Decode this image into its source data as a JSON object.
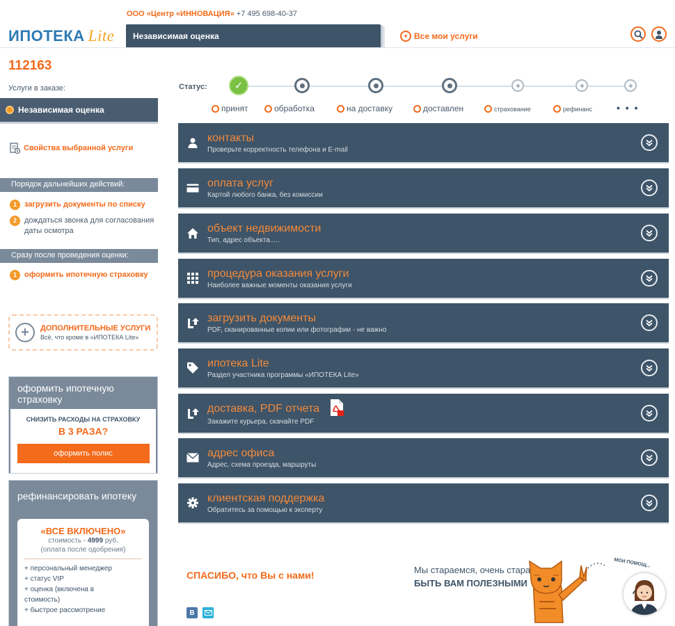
{
  "header": {
    "company_name": "ООО «Центр «ИННОВАЦИЯ»",
    "phone": "+7 495 698-40-37",
    "logo_word": "ИПОТЕКА",
    "logo_lite": "Lite",
    "active_tab": "Независимая оценка",
    "all_services_label": "Все мои услуги",
    "icons": [
      "search-icon",
      "user-icon"
    ]
  },
  "order": {
    "number": "112163",
    "services_caption": "Услуги в заказе:",
    "selected_service": "Независимая оценка",
    "properties_link": "Свойства выбранной услуги"
  },
  "next_steps": {
    "heading": "Порядок дальнейших действий:",
    "items": [
      {
        "num": "1",
        "text": "загрузить документы по списку"
      },
      {
        "num": "2",
        "text": "дождаться звонка для согласования даты осмотра"
      }
    ]
  },
  "after_eval": {
    "heading": "Сразу после проведения оценки:",
    "items": [
      {
        "num": "1",
        "text": "оформить ипотечную страховку"
      }
    ]
  },
  "extra_services": {
    "title": "ДОПОЛНИТЕЛЬНЫЕ УСЛУГИ",
    "subtitle": "Всё, что кроме в «ИПОТЕКА Lite»"
  },
  "insurance_promo": {
    "heading": "оформить ипотечную страховку",
    "small": "СНИЗИТЬ РАСХОДЫ НА СТРАХОВКУ",
    "big": "В 3 РАЗА?",
    "button": "оформить полис"
  },
  "refinance_promo": {
    "heading": "рефинансировать ипотеку",
    "big": "«ВСЕ ВКЛЮЧЕНО»",
    "price_prefix": "стоимость -",
    "price": "4999",
    "price_suffix": "руб.",
    "price_note": "(оплата после одобрения)",
    "features": [
      "+ персональный менеджер",
      "+ статус VIP",
      "+ оценка (включена в",
      "стоимость)",
      "+ быстрое рассмотрение"
    ]
  },
  "status": {
    "label": "Статус:",
    "steps": [
      {
        "label": "принят",
        "state": "done"
      },
      {
        "label": "обработка",
        "state": "active"
      },
      {
        "label": "на доставку",
        "state": "active"
      },
      {
        "label": "доставлен",
        "state": "active"
      },
      {
        "label": "страхование",
        "state": "pending"
      },
      {
        "label": "рефинанс",
        "state": "pending"
      },
      {
        "label": "",
        "state": "pending"
      }
    ],
    "more": "• • •"
  },
  "sections": [
    {
      "title": "контакты",
      "subtitle": "Проверьте корректность телефона и E-mail",
      "icon": "person-icon"
    },
    {
      "title": "оплата услуг",
      "subtitle": "Картой любого банка, без комиссии",
      "icon": "card-icon"
    },
    {
      "title": "объект недвижимости",
      "subtitle": "Тип, адрес объекта.....",
      "icon": "home-icon"
    },
    {
      "title": "процедура оказания услуги",
      "subtitle": "Наиболее важные моменты оказания услуги",
      "icon": "grid-icon"
    },
    {
      "title": "загрузить документы",
      "subtitle": "PDF, сканированные копии или фотографии - не важно",
      "icon": "upload-icon"
    },
    {
      "title": "ипотека Lite",
      "subtitle": "Раздел участника программы «ИПОТЕКА Lite»",
      "icon": "tag-icon"
    },
    {
      "title": "доставка, PDF отчета",
      "subtitle": "Закажите курьера, скачайте PDF",
      "icon": "delivery-icon",
      "badge": "pdf-icon"
    },
    {
      "title": "адрес офиса",
      "subtitle": "Адрес, схема проезда, маршруты",
      "icon": "envelope-icon"
    },
    {
      "title": "клиентская поддержка",
      "subtitle": "Обратитесь за помощью к эксперту",
      "icon": "gear-icon"
    }
  ],
  "footer": {
    "thanks": "СПАСИБО, что Вы с нами!",
    "try_line1": "Мы стараемся, очень стараемся",
    "try_line2": "БЫТЬ ВАМ ПОЛЕЗНЫМИ",
    "help_caption": "МОИ ПОМОЩ...",
    "social": [
      "В",
      "mail-icon"
    ]
  },
  "colors": {
    "accent": "#f26a1b",
    "panel": "#3e5468",
    "success": "#7ac043"
  }
}
